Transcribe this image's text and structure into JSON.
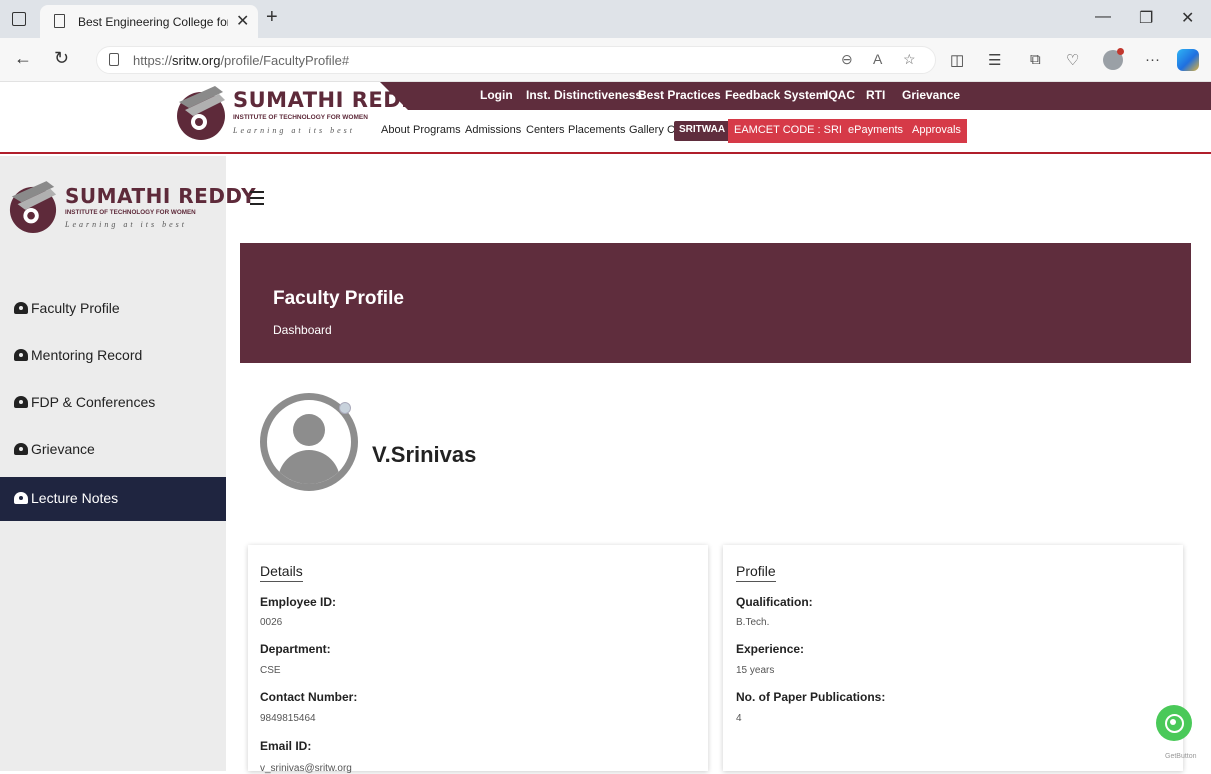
{
  "browser": {
    "tab_title": "Best Engineering College for Wo",
    "url_prefix": "https://",
    "url_domain": "sritw.org",
    "url_path": "/profile/FacultyProfile#"
  },
  "site": {
    "logo_title": "SUMATHI REDDY",
    "logo_subtitle": "INSTITUTE OF TECHNOLOGY FOR WOMEN",
    "logo_tagline": "Learning at its best",
    "top_menu": [
      "Login",
      "Inst. Distinctiveness",
      "Best Practices",
      "Feedback System",
      "IQAC",
      "RTI",
      "Grievance"
    ],
    "main_menu": [
      "About",
      "Programs",
      "Admissions",
      "Centers",
      "Placements",
      "Gallery",
      "Contact"
    ],
    "pills": [
      "SRITWAA",
      "EAMCET CODE : SRIW",
      "ePayments",
      "Approvals"
    ],
    "colors": {
      "brand": "#5f2d3d",
      "accent_red": "#d63a48",
      "sidebar_active": "#1f2540"
    }
  },
  "sidebar": {
    "items": [
      {
        "label": "Faculty Profile",
        "icon": "dashboard-icon"
      },
      {
        "label": "Mentoring Record",
        "icon": "dashboard-icon"
      },
      {
        "label": "FDP & Conferences",
        "icon": "dashboard-icon"
      },
      {
        "label": "Grievance",
        "icon": "dashboard-icon"
      },
      {
        "label": "Lecture Notes",
        "icon": "dashboard-icon",
        "active": true
      }
    ]
  },
  "banner": {
    "title": "Faculty Profile",
    "subtitle": "Dashboard"
  },
  "faculty": {
    "name": "V.Srinivas"
  },
  "details": {
    "title": "Details",
    "fields": [
      {
        "label": "Employee ID:",
        "value": "0026"
      },
      {
        "label": "Department:",
        "value": "CSE"
      },
      {
        "label": "Contact Number:",
        "value": "9849815464"
      },
      {
        "label": "Email ID:",
        "value": "v_srinivas@sritw.org"
      }
    ]
  },
  "profile": {
    "title": "Profile",
    "fields": [
      {
        "label": "Qualification:",
        "value": "B.Tech."
      },
      {
        "label": "Experience:",
        "value": "15 years"
      },
      {
        "label": "No. of Paper Publications:",
        "value": "4"
      }
    ]
  },
  "widgets": {
    "getbutton": "GetButton"
  }
}
